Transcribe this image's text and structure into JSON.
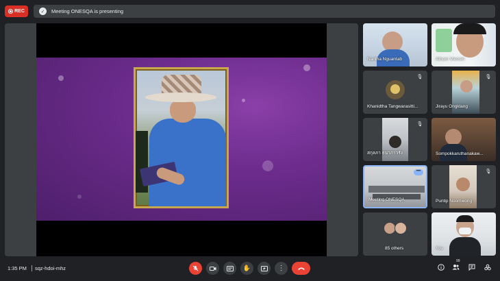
{
  "topbar": {
    "rec_label": "REC",
    "presenting_text": "Meeting ONESQA is presenting"
  },
  "participants": [
    {
      "name": "Nantha Nguantab",
      "mic_off": false
    },
    {
      "name": "Athorn Viensiri",
      "mic_off": false
    },
    {
      "name": "Khanidtha Tangwarasitti...",
      "mic_off": true
    },
    {
      "name": "Jirayu Ongklang",
      "mic_off": true
    },
    {
      "name": "สกุลภา ธนาภาวรัง",
      "mic_off": true
    },
    {
      "name": "Sompokkaruthanakaw...",
      "mic_off": true
    },
    {
      "name": "Meeting ONESQA",
      "mic_off": false,
      "active": true
    },
    {
      "name": "Puntip Noomwong",
      "mic_off": true
    },
    {
      "name": "85 others",
      "mic_off": false
    },
    {
      "name": "You",
      "mic_off": false
    }
  ],
  "bottombar": {
    "time": "1:35 PM",
    "meeting_code": "sqz-hdoi-mhz",
    "participant_count": "99"
  },
  "icons": {
    "mic": "mic-off-icon",
    "camera": "camera-icon",
    "captions": "captions-icon",
    "hand": "raise-hand-icon",
    "present": "present-icon",
    "more": "more-vert-icon",
    "end": "end-call-icon",
    "info": "info-icon",
    "people": "people-icon",
    "chat": "chat-icon",
    "activities": "activities-icon"
  },
  "colors": {
    "background": "#202124",
    "tile": "#3c4043",
    "rec": "#d93025",
    "end_call": "#ea4335",
    "active_border": "#8ab4f8",
    "slide_purple": "#6c2c8c"
  }
}
